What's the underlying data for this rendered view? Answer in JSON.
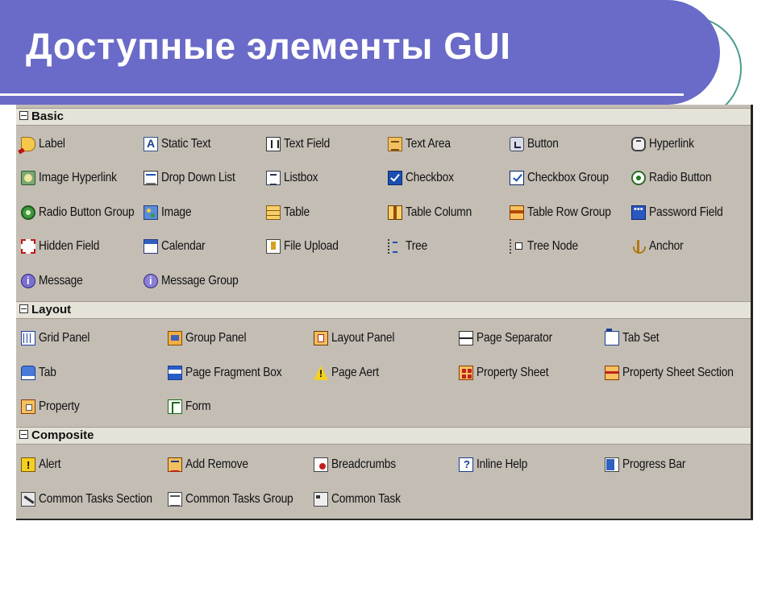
{
  "slide": {
    "title": "Доступные элементы GUI"
  },
  "palette": {
    "sections": [
      {
        "name": "Basic",
        "items": [
          {
            "label": "Label",
            "icon": "label-icon"
          },
          {
            "label": "Static Text",
            "icon": "static-text-icon"
          },
          {
            "label": "Text Field",
            "icon": "text-field-icon"
          },
          {
            "label": "Text Area",
            "icon": "text-area-icon"
          },
          {
            "label": "Button",
            "icon": "button-icon"
          },
          {
            "label": "Hyperlink",
            "icon": "hyperlink-icon"
          },
          {
            "label": "Image Hyperlink",
            "icon": "image-hyperlink-icon"
          },
          {
            "label": "Drop Down List",
            "icon": "drop-down-list-icon"
          },
          {
            "label": "Listbox",
            "icon": "listbox-icon"
          },
          {
            "label": "Checkbox",
            "icon": "checkbox-icon"
          },
          {
            "label": "Checkbox Group",
            "icon": "checkbox-group-icon"
          },
          {
            "label": "Radio Button",
            "icon": "radio-button-icon"
          },
          {
            "label": "Radio Button Group",
            "icon": "radio-button-group-icon"
          },
          {
            "label": "Image",
            "icon": "image-icon"
          },
          {
            "label": "Table",
            "icon": "table-icon"
          },
          {
            "label": "Table Column",
            "icon": "table-column-icon"
          },
          {
            "label": "Table Row Group",
            "icon": "table-row-group-icon"
          },
          {
            "label": "Password Field",
            "icon": "password-field-icon"
          },
          {
            "label": "Hidden Field",
            "icon": "hidden-field-icon"
          },
          {
            "label": "Calendar",
            "icon": "calendar-icon"
          },
          {
            "label": "File Upload",
            "icon": "file-upload-icon"
          },
          {
            "label": "Tree",
            "icon": "tree-icon"
          },
          {
            "label": "Tree Node",
            "icon": "tree-node-icon"
          },
          {
            "label": "Anchor",
            "icon": "anchor-icon"
          },
          {
            "label": "Message",
            "icon": "message-icon"
          },
          {
            "label": "Message Group",
            "icon": "message-group-icon"
          }
        ]
      },
      {
        "name": "Layout",
        "items": [
          {
            "label": "Grid Panel",
            "icon": "grid-panel-icon"
          },
          {
            "label": "Group Panel",
            "icon": "group-panel-icon"
          },
          {
            "label": "Layout Panel",
            "icon": "layout-panel-icon"
          },
          {
            "label": "Page Separator",
            "icon": "page-separator-icon"
          },
          {
            "label": "Tab Set",
            "icon": "tab-set-icon"
          },
          {
            "label": "Tab",
            "icon": "tab-icon"
          },
          {
            "label": "Page Fragment Box",
            "icon": "page-fragment-box-icon"
          },
          {
            "label": "Page Aert",
            "icon": "page-alert-icon"
          },
          {
            "label": "Property Sheet",
            "icon": "property-sheet-icon"
          },
          {
            "label": "Property Sheet Section",
            "icon": "property-sheet-section-icon"
          },
          {
            "label": "Property",
            "icon": "property-icon"
          },
          {
            "label": "Form",
            "icon": "form-icon"
          }
        ]
      },
      {
        "name": "Composite",
        "items": [
          {
            "label": "Alert",
            "icon": "alert-icon"
          },
          {
            "label": "Add Remove",
            "icon": "add-remove-icon"
          },
          {
            "label": "Breadcrumbs",
            "icon": "breadcrumbs-icon"
          },
          {
            "label": "Inline Help",
            "icon": "inline-help-icon"
          },
          {
            "label": "Progress Bar",
            "icon": "progress-bar-icon"
          },
          {
            "label": "Common Tasks Section",
            "icon": "common-tasks-section-icon"
          },
          {
            "label": "Common Tasks Group",
            "icon": "common-tasks-group-icon"
          },
          {
            "label": "Common Task",
            "icon": "common-task-icon"
          }
        ]
      }
    ]
  }
}
